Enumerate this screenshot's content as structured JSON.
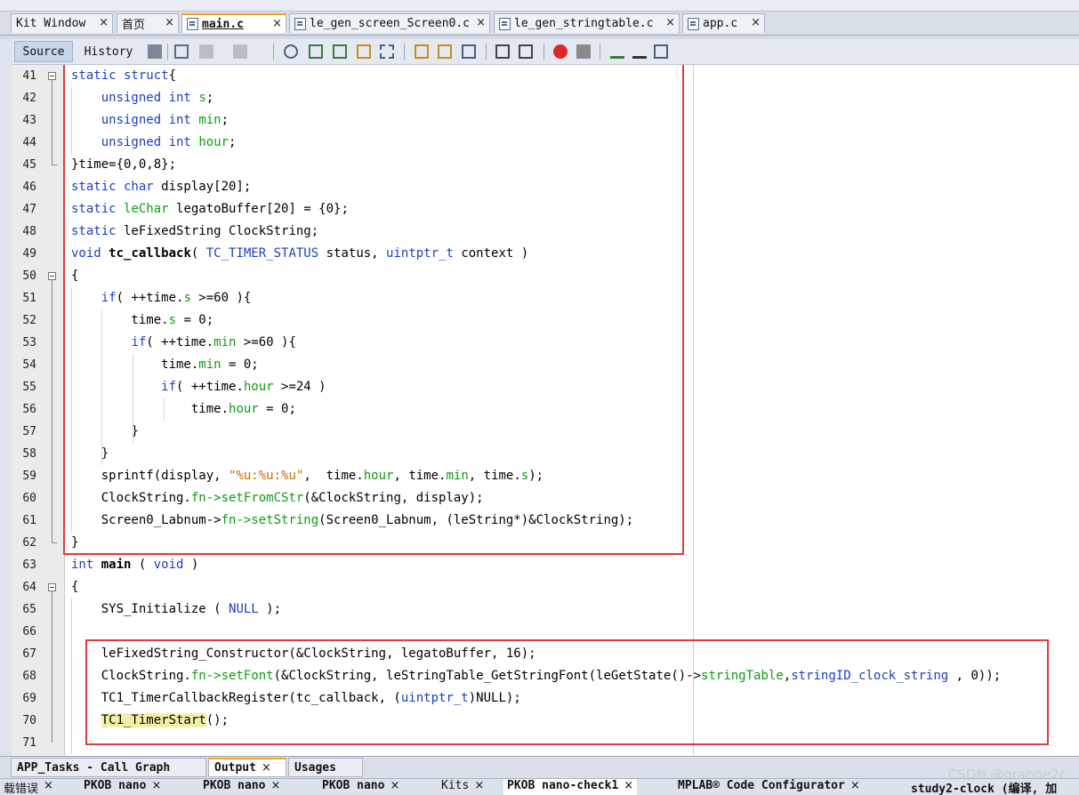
{
  "editor_tabs": [
    {
      "label": "Kit Window",
      "icon": "",
      "active": false
    },
    {
      "label": "首页",
      "icon": "",
      "active": false
    },
    {
      "label": "main.c",
      "icon": "c-file-icon",
      "active": true
    },
    {
      "label": "le_gen_screen_Screen0.c",
      "icon": "c-file-icon",
      "active": false
    },
    {
      "label": "le_gen_stringtable.c",
      "icon": "c-file-icon",
      "active": false
    },
    {
      "label": "app.c",
      "icon": "c-file-icon",
      "active": false
    }
  ],
  "close_glyph": "×",
  "toolbar": {
    "source_label": "Source",
    "history_label": "History"
  },
  "line_numbers": [
    "41",
    "42",
    "43",
    "44",
    "45",
    "46",
    "47",
    "48",
    "49",
    "50",
    "51",
    "52",
    "53",
    "54",
    "55",
    "56",
    "57",
    "58",
    "59",
    "60",
    "61",
    "62",
    "63",
    "64",
    "65",
    "66",
    "67",
    "68",
    "69",
    "70",
    "71"
  ],
  "code_lines": [
    [
      {
        "t": "static struct",
        "c": "kw"
      },
      {
        "t": "{"
      }
    ],
    [
      {
        "t": "    "
      },
      {
        "t": "unsigned int",
        "c": "kw"
      },
      {
        "t": " "
      },
      {
        "t": "s",
        "c": "fld"
      },
      {
        "t": ";"
      }
    ],
    [
      {
        "t": "    "
      },
      {
        "t": "unsigned int",
        "c": "kw"
      },
      {
        "t": " "
      },
      {
        "t": "min",
        "c": "fld"
      },
      {
        "t": ";"
      }
    ],
    [
      {
        "t": "    "
      },
      {
        "t": "unsigned int",
        "c": "kw"
      },
      {
        "t": " "
      },
      {
        "t": "hour",
        "c": "fld"
      },
      {
        "t": ";"
      }
    ],
    [
      {
        "t": "}time={0,0,8};"
      }
    ],
    [
      {
        "t": "static char",
        "c": "kw"
      },
      {
        "t": " display[20];"
      }
    ],
    [
      {
        "t": "static",
        "c": "kw"
      },
      {
        "t": " "
      },
      {
        "t": "leChar",
        "c": "fld"
      },
      {
        "t": " legatoBuffer[20] = {0};"
      }
    ],
    [
      {
        "t": "static",
        "c": "kw"
      },
      {
        "t": " leFixedString ClockString;"
      }
    ],
    [
      {
        "t": "void",
        "c": "kw"
      },
      {
        "t": " "
      },
      {
        "t": "tc_callback",
        "c": "fn"
      },
      {
        "t": "( "
      },
      {
        "t": "TC_TIMER_STATUS",
        "c": "kw"
      },
      {
        "t": " status, "
      },
      {
        "t": "uintptr_t",
        "c": "kw"
      },
      {
        "t": " context )"
      }
    ],
    [
      {
        "t": "{"
      }
    ],
    [
      {
        "t": "    "
      },
      {
        "t": "if",
        "c": "kw"
      },
      {
        "t": "( ++time."
      },
      {
        "t": "s",
        "c": "fld"
      },
      {
        "t": " >=60 ){"
      }
    ],
    [
      {
        "t": "        time."
      },
      {
        "t": "s",
        "c": "fld"
      },
      {
        "t": " = 0;"
      }
    ],
    [
      {
        "t": "        "
      },
      {
        "t": "if",
        "c": "kw"
      },
      {
        "t": "( ++time."
      },
      {
        "t": "min",
        "c": "fld"
      },
      {
        "t": " >=60 ){"
      }
    ],
    [
      {
        "t": "            time."
      },
      {
        "t": "min",
        "c": "fld"
      },
      {
        "t": " = 0;"
      }
    ],
    [
      {
        "t": "            "
      },
      {
        "t": "if",
        "c": "kw"
      },
      {
        "t": "( ++time."
      },
      {
        "t": "hour",
        "c": "fld"
      },
      {
        "t": " >=24 )"
      }
    ],
    [
      {
        "t": "                time."
      },
      {
        "t": "hour",
        "c": "fld"
      },
      {
        "t": " = 0;"
      }
    ],
    [
      {
        "t": "        }"
      }
    ],
    [
      {
        "t": "    }"
      }
    ],
    [
      {
        "t": "    sprintf(display, "
      },
      {
        "t": "\"%u:%u:%u\"",
        "c": "str"
      },
      {
        "t": ",  time."
      },
      {
        "t": "hour",
        "c": "fld"
      },
      {
        "t": ", time."
      },
      {
        "t": "min",
        "c": "fld"
      },
      {
        "t": ", time."
      },
      {
        "t": "s",
        "c": "fld"
      },
      {
        "t": ");"
      }
    ],
    [
      {
        "t": "    ClockString."
      },
      {
        "t": "fn",
        "c": "fld"
      },
      {
        "t": "->",
        "c": "fld"
      },
      {
        "t": "setFromCStr",
        "c": "fld"
      },
      {
        "t": "(&ClockString, display);"
      }
    ],
    [
      {
        "t": "    Screen0_Labnum->"
      },
      {
        "t": "fn",
        "c": "fld"
      },
      {
        "t": "->",
        "c": "fld"
      },
      {
        "t": "setString",
        "c": "fld"
      },
      {
        "t": "(Screen0_Labnum, (leString*)&ClockString);"
      }
    ],
    [
      {
        "t": "}"
      }
    ],
    [
      {
        "t": "int",
        "c": "kw"
      },
      {
        "t": " "
      },
      {
        "t": "main",
        "c": "fn"
      },
      {
        "t": " ( "
      },
      {
        "t": "void",
        "c": "kw"
      },
      {
        "t": " )"
      }
    ],
    [
      {
        "t": "{"
      }
    ],
    [
      {
        "t": "    SYS_Initialize ( "
      },
      {
        "t": "NULL",
        "c": "kw"
      },
      {
        "t": " );"
      }
    ],
    [
      {
        "t": ""
      }
    ],
    [
      {
        "t": "    leFixedString_Constructor(&ClockString, legatoBuffer, 16);"
      }
    ],
    [
      {
        "t": "    ClockString."
      },
      {
        "t": "fn",
        "c": "fld"
      },
      {
        "t": "->",
        "c": "fld"
      },
      {
        "t": "setFont",
        "c": "fld"
      },
      {
        "t": "(&ClockString, leStringTable_GetStringFont(leGetState()->"
      },
      {
        "t": "stringTable",
        "c": "fld"
      },
      {
        "t": ","
      },
      {
        "t": "stringID_clock_string",
        "c": "kw"
      },
      {
        "t": " , 0));"
      }
    ],
    [
      {
        "t": "    TC1_TimerCallbackRegister(tc_callback, ("
      },
      {
        "t": "uintptr_t",
        "c": "kw"
      },
      {
        "t": ")NULL);"
      }
    ],
    [
      {
        "t": "    "
      },
      {
        "t": "TC1_TimerStart",
        "c": "hl"
      },
      {
        "t": "();"
      }
    ],
    [
      {
        "t": ""
      }
    ]
  ],
  "bottom_tabs": [
    {
      "label": "APP_Tasks - Call Graph",
      "active": false
    },
    {
      "label": "Output",
      "active": true
    },
    {
      "label": "Usages",
      "active": false
    }
  ],
  "status_tabs": [
    "载错误",
    "PKOB nano",
    "PKOB nano",
    "PKOB nano",
    "Kits",
    "PKOB nano-check1",
    "MPLAB® Code Configurator",
    "study2-clock (编译, 加"
  ],
  "watermark": "CSDN @orange2c",
  "colors": {
    "keyword": "#1c3fc6",
    "field": "#109c10",
    "string": "#c96a00",
    "highlight_box": "#e03b3b",
    "active_tab_accent": "#f5a623"
  }
}
